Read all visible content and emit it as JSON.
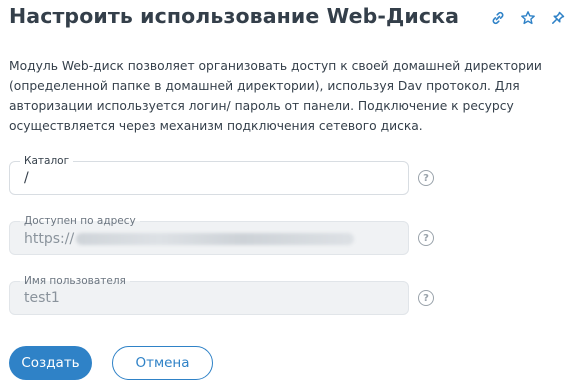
{
  "header": {
    "title": "Настроить использование Web-Диска",
    "icons": [
      "link-icon",
      "star-icon",
      "pin-icon"
    ]
  },
  "description": "Модуль Web-диск позволяет организовать доступ к своей домашней директории (определенной папке в домашней директории), используя Dav протокол. Для авторизации используется логин/ пароль от панели. Подключение к ресурсу осуществляется через механизм подключения сетевого диска.",
  "form": {
    "catalog": {
      "label": "Каталог",
      "value": "/"
    },
    "address": {
      "label": "Доступен по адресу",
      "value": "https://"
    },
    "username": {
      "label": "Имя пользователя",
      "value": "test1"
    },
    "help_glyph": "?"
  },
  "buttons": {
    "create": "Создать",
    "cancel": "Отмена"
  },
  "colors": {
    "accent": "#2f82c7",
    "text": "#343f4a",
    "disabled_bg": "#f0f2f4"
  }
}
